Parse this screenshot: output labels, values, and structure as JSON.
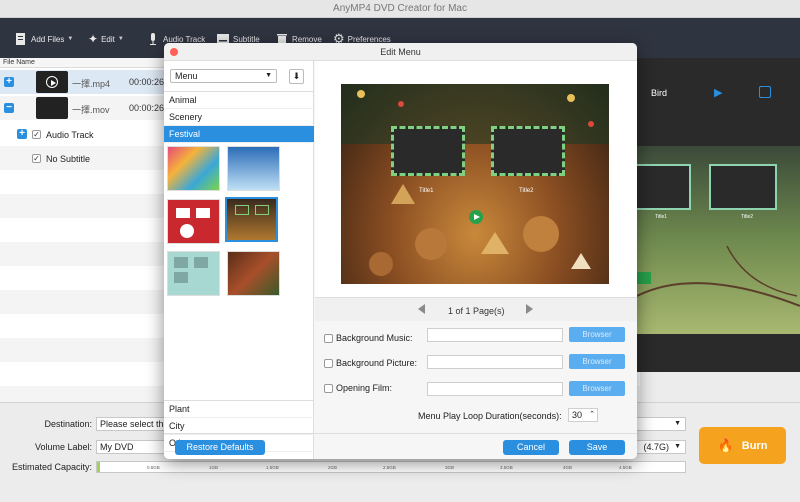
{
  "app": {
    "title": "AnyMP4 DVD Creator for Mac"
  },
  "toolbar": {
    "add_files": "Add Files",
    "edit": "Edit",
    "audio_track": "Audio Track",
    "subtitle": "Subtitle",
    "remove": "Remove",
    "preferences": "Preferences"
  },
  "filelist": {
    "header": "File Name",
    "files": [
      {
        "name": "一擇.mp4",
        "time": "00:00:26"
      },
      {
        "name": "一擇.mov",
        "time": "00:00:26"
      }
    ],
    "audio_track": "Audio Track",
    "subtitle": "No Subtitle"
  },
  "preview": {
    "title": "Bird",
    "thumbs": [
      "Title1",
      "Title2"
    ]
  },
  "dialog": {
    "title": "Edit Menu",
    "menu_select": "Menu",
    "categories": [
      "Animal",
      "Scenery",
      "Festival"
    ],
    "categories_bottom": [
      "Plant",
      "City",
      "Other"
    ],
    "page_label": "1 of 1 Page(s)",
    "thumb_labels": [
      "Title1",
      "Title2"
    ],
    "options": {
      "background_music": "Background Music:",
      "background_picture": "Background Picture:",
      "opening_film": "Opening Film:",
      "browser": "Browser",
      "loop_label": "Menu Play Loop Duration(seconds):",
      "loop_value": "30"
    },
    "buttons": {
      "restore": "Restore Defaults",
      "cancel": "Cancel",
      "save": "Save"
    }
  },
  "bottom": {
    "destination_label": "Destination:",
    "destination_value": "Please select th",
    "volume_label": "Volume Label:",
    "volume_value": "My DVD",
    "capacity_label": "Estimated Capacity:",
    "size_value": "(4.7G)",
    "burn": "Burn",
    "ticks": [
      "0.5GB",
      "1GB",
      "1.5GB",
      "2GB",
      "2.5GB",
      "3GB",
      "3.5GB",
      "4GB",
      "4.5GB"
    ]
  },
  "colors": {
    "accent": "#2b8fe0",
    "burn": "#f5a31e",
    "toolbar": "#2f3441"
  }
}
